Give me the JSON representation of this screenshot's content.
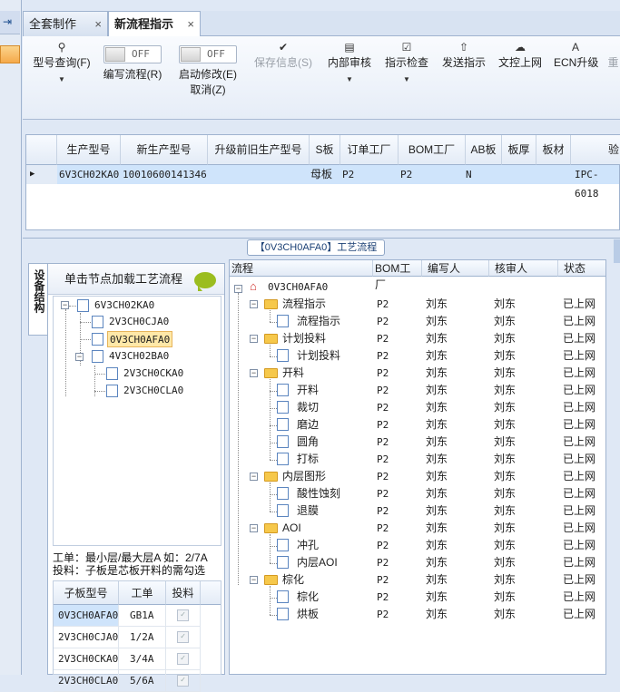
{
  "tabs": [
    {
      "label": "全套制作",
      "close": "×"
    },
    {
      "label": "新流程指示",
      "close": "×"
    }
  ],
  "toolbar": {
    "query": "型号查询(F)",
    "write_toggle": "OFF",
    "write": "编写流程(R)",
    "start_toggle": "OFF",
    "start_line1": "启动修改(E)",
    "start_line2": "取消(Z)",
    "save": "保存信息(S)",
    "internal": "内部审核",
    "check": "指示检查",
    "send": "发送指示",
    "upload": "文控上网",
    "ecn": "ECN升级",
    "more": "重"
  },
  "grid": {
    "columns": [
      "生产型号",
      "新生产型号",
      "升级前旧生产型号",
      "S板",
      "订单工厂",
      "BOM工厂",
      "AB板",
      "板厚",
      "板材",
      "验"
    ],
    "row": [
      "6V3CH02KA0",
      "10010600141346",
      "",
      "母板",
      "P2",
      "P2",
      "N",
      "",
      "",
      "IPC-6018"
    ]
  },
  "flow_title": "【0V3CH0AFA0】工艺流程",
  "vtab": "设备结构",
  "left": {
    "header": "单击节点加载工艺流程",
    "tree": [
      {
        "label": "6V3CH02KA0"
      },
      {
        "label": "2V3CH0CJA0"
      },
      {
        "label": "0V3CH0AFA0"
      },
      {
        "label": "4V3CH02BA0"
      },
      {
        "label": "2V3CH0CKA0"
      },
      {
        "label": "2V3CH0CLA0"
      }
    ],
    "info1": "工单：最小层/最大层A 如：2/7A",
    "info2": "投料：子板是芯板开料的需勾选",
    "sub_columns": [
      "子板型号",
      "工单",
      "投料"
    ],
    "sub_rows": [
      {
        "model": "0V3CH0AFA0",
        "order": "GB1A"
      },
      {
        "model": "2V3CH0CJA0",
        "order": "1/2A"
      },
      {
        "model": "2V3CH0CKA0",
        "order": "3/4A"
      },
      {
        "model": "2V3CH0CLA0",
        "order": "5/6A"
      }
    ]
  },
  "right": {
    "columns": [
      "流程",
      "BOM工厂",
      "编写人",
      "核审人",
      "状态"
    ],
    "root": "0V3CH0AFA0",
    "rows": [
      {
        "name": "流程指示",
        "bom": "P2",
        "writer": "刘东",
        "auditor": "刘东",
        "status": "已上网"
      },
      {
        "name": "流程指示",
        "bom": "P2",
        "writer": "刘东",
        "auditor": "刘东",
        "status": "已上网"
      },
      {
        "name": "计划投料",
        "bom": "P2",
        "writer": "刘东",
        "auditor": "刘东",
        "status": "已上网"
      },
      {
        "name": "计划投料",
        "bom": "P2",
        "writer": "刘东",
        "auditor": "刘东",
        "status": "已上网"
      },
      {
        "name": "开料",
        "bom": "P2",
        "writer": "刘东",
        "auditor": "刘东",
        "status": "已上网"
      },
      {
        "name": "开料",
        "bom": "P2",
        "writer": "刘东",
        "auditor": "刘东",
        "status": "已上网"
      },
      {
        "name": "裁切",
        "bom": "P2",
        "writer": "刘东",
        "auditor": "刘东",
        "status": "已上网"
      },
      {
        "name": "磨边",
        "bom": "P2",
        "writer": "刘东",
        "auditor": "刘东",
        "status": "已上网"
      },
      {
        "name": "圆角",
        "bom": "P2",
        "writer": "刘东",
        "auditor": "刘东",
        "status": "已上网"
      },
      {
        "name": "打标",
        "bom": "P2",
        "writer": "刘东",
        "auditor": "刘东",
        "status": "已上网"
      },
      {
        "name": "内层图形",
        "bom": "P2",
        "writer": "刘东",
        "auditor": "刘东",
        "status": "已上网"
      },
      {
        "name": "酸性蚀刻",
        "bom": "P2",
        "writer": "刘东",
        "auditor": "刘东",
        "status": "已上网"
      },
      {
        "name": "退膜",
        "bom": "P2",
        "writer": "刘东",
        "auditor": "刘东",
        "status": "已上网"
      },
      {
        "name": "AOI",
        "bom": "P2",
        "writer": "刘东",
        "auditor": "刘东",
        "status": "已上网"
      },
      {
        "name": "冲孔",
        "bom": "P2",
        "writer": "刘东",
        "auditor": "刘东",
        "status": "已上网"
      },
      {
        "name": "内层AOI",
        "bom": "P2",
        "writer": "刘东",
        "auditor": "刘东",
        "status": "已上网"
      },
      {
        "name": "棕化",
        "bom": "P2",
        "writer": "刘东",
        "auditor": "刘东",
        "status": "已上网"
      },
      {
        "name": "棕化",
        "bom": "P2",
        "writer": "刘东",
        "auditor": "刘东",
        "status": "已上网"
      },
      {
        "name": "烘板",
        "bom": "P2",
        "writer": "刘东",
        "auditor": "刘东",
        "status": "已上网"
      }
    ]
  }
}
